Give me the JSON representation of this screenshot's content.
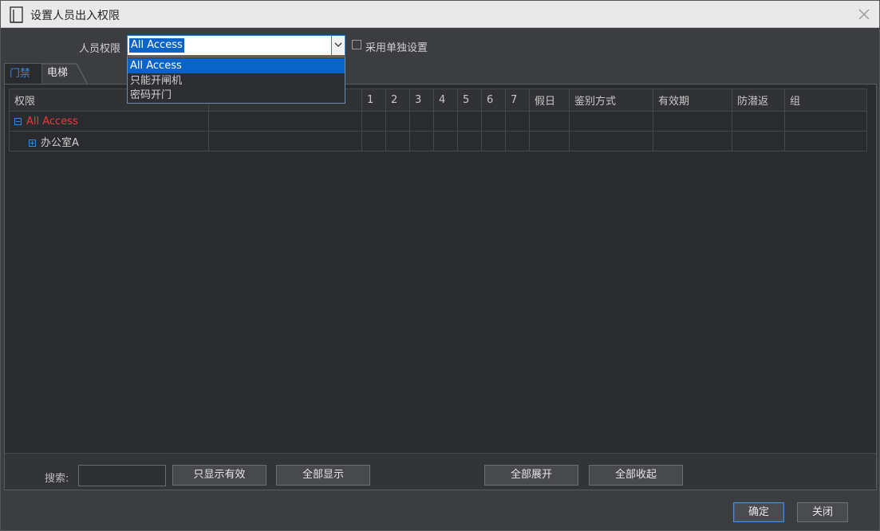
{
  "window": {
    "title": "设置人员出入权限"
  },
  "permission": {
    "label": "人员权限",
    "selected": "All Access",
    "options": [
      "All Access",
      "只能开闸机",
      "密码开门"
    ],
    "separate_setting_label": "采用单独设置"
  },
  "tabs": [
    "门禁",
    "电梯"
  ],
  "grid": {
    "columns": [
      "权限",
      "",
      "1",
      "2",
      "3",
      "4",
      "5",
      "6",
      "7",
      "假日",
      "鉴别方式",
      "有效期",
      "防潜返",
      "组"
    ],
    "rows": [
      {
        "label": "All Access",
        "expanded": true
      },
      {
        "label": "办公室A",
        "expanded": false
      }
    ]
  },
  "footer": {
    "search_label": "搜索:",
    "search_value": "",
    "btn_show_valid": "只显示有效",
    "btn_show_all": "全部显示",
    "btn_expand_all": "全部展开",
    "btn_collapse_all": "全部收起"
  },
  "actions": {
    "confirm": "确定",
    "close": "关闭"
  },
  "colors": {
    "accent": "#0a64c8",
    "tree_root": "#e53b3b",
    "tab_active_text": "#3a86d8"
  }
}
